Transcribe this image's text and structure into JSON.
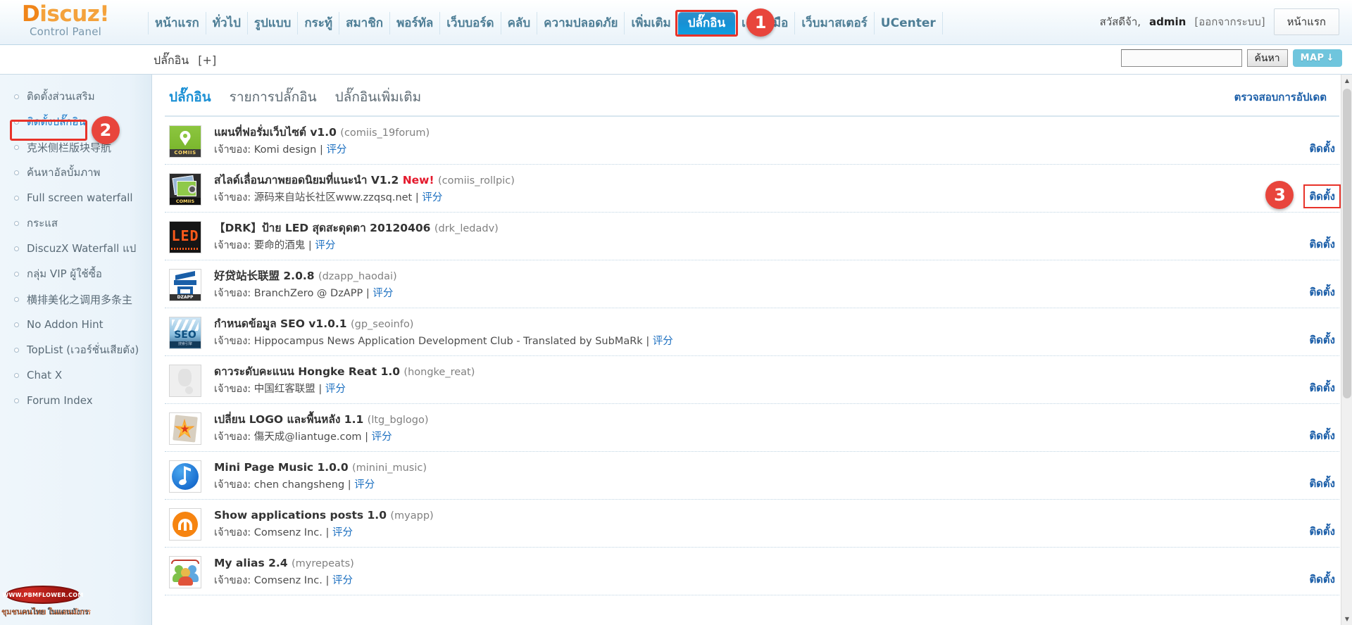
{
  "brand": {
    "name_d": "D",
    "name_rest": "iscuz!",
    "subtitle": "Control Panel"
  },
  "topnav": {
    "items": [
      {
        "label": "หน้าแรก",
        "active": false
      },
      {
        "label": "ทั่วไป",
        "active": false
      },
      {
        "label": "รูปแบบ",
        "active": false
      },
      {
        "label": "กระทู้",
        "active": false
      },
      {
        "label": "สมาชิก",
        "active": false
      },
      {
        "label": "พอร์ทัล",
        "active": false
      },
      {
        "label": "เว็บบอร์ด",
        "active": false
      },
      {
        "label": "คลับ",
        "active": false
      },
      {
        "label": "ความปลอดภัย",
        "active": false
      },
      {
        "label": "เพิ่มเติม",
        "active": false
      },
      {
        "label": "ปลั๊กอิน",
        "active": true
      },
      {
        "label": "เครื่องมือ",
        "active": false
      },
      {
        "label": "เว็บมาสเตอร์",
        "active": false
      },
      {
        "label": "UCenter",
        "active": false
      }
    ]
  },
  "user": {
    "greeting": "สวัสดีจ้า,",
    "username": "admin",
    "logout": "[ออกจากระบบ]",
    "home_button": "หน้าแรก"
  },
  "subbar": {
    "breadcrumb": "ปลั๊กอิน",
    "expand": "[+]",
    "search_value": "",
    "search_placeholder": "",
    "search_button": "ค้นหา",
    "map_button": "MAP"
  },
  "sidebar": {
    "items": [
      {
        "label": "ติดตั้งส่วนเสริม",
        "selected": false
      },
      {
        "label": "ติดตั้งปลั๊กอิน",
        "selected": true
      },
      {
        "label": "克米侧栏版块导航",
        "selected": false
      },
      {
        "label": "ค้นหาอัลบั้มภาพ",
        "selected": false
      },
      {
        "label": "Full screen waterfall",
        "selected": false
      },
      {
        "label": "กระแส",
        "selected": false
      },
      {
        "label": "DiscuzX Waterfall แป",
        "selected": false
      },
      {
        "label": "กลุ่ม VIP ผู้ใช้ซื้อ",
        "selected": false
      },
      {
        "label": "横排美化之调用多条主",
        "selected": false
      },
      {
        "label": "No Addon Hint",
        "selected": false
      },
      {
        "label": "TopList (เวอร์ชั่นเสียตัง)",
        "selected": false
      },
      {
        "label": "Chat X",
        "selected": false
      },
      {
        "label": "Forum Index",
        "selected": false
      }
    ]
  },
  "content": {
    "tabs": [
      {
        "label": "ปลั๊กอิน",
        "active": true
      },
      {
        "label": "รายการปลั๊กอิน",
        "active": false
      },
      {
        "label": "ปลั๊กอินเพิ่มเติม",
        "active": false
      }
    ],
    "check_update": "ตรวจสอบการอัปเดต",
    "owner_prefix": "เจ้าของ:",
    "rate_label": "评分",
    "install_label": "ติดตั้ง",
    "plugins": [
      {
        "title": "แผนที่ฟอรั่มเว็บไซต์ v1.0",
        "id": "(comiis_19forum)",
        "is_new": false,
        "new_label": "",
        "author": "Komi design",
        "icon": "map-pin-icon",
        "icon_text": "COMIIS"
      },
      {
        "title": "สไลด์เลื่อนภาพยอดนิยมที่แนะนำ V1.2",
        "id": "(comiis_rollpic)",
        "is_new": true,
        "new_label": "New!",
        "author": "源码来自站长社区www.zzqsq.net",
        "icon": "photo-slider-icon",
        "icon_text": "COMIIS"
      },
      {
        "title": "【DRK】ป้าย LED สุดสะดุดตา 20120406",
        "id": "(drk_ledadv)",
        "is_new": false,
        "new_label": "",
        "author": "要命的酒鬼",
        "icon": "led-sign-icon",
        "icon_text": "LED"
      },
      {
        "title": "好贷站长联盟 2.0.8",
        "id": "(dzapp_haodai)",
        "is_new": false,
        "new_label": "",
        "author": "BranchZero @ DzAPP",
        "icon": "dzapp-icon",
        "icon_text": "DZAPP"
      },
      {
        "title": "กำหนดข้อมูล SEO v1.0.1",
        "id": "(gp_seoinfo)",
        "is_new": false,
        "new_label": "",
        "author": "Hippocampus News Application Development Club - Translated by SubMaRk",
        "icon": "seo-icon",
        "icon_text": "SEO"
      },
      {
        "title": "ดาวระดับคะแนน Hongke Reat 1.0",
        "id": "(hongke_reat)",
        "is_new": false,
        "new_label": "",
        "author": "中国红客联盟",
        "icon": "blank-icon",
        "icon_text": ""
      },
      {
        "title": "เปลี่ยน LOGO และพื้นหลัง 1.1",
        "id": "(ltg_bglogo)",
        "is_new": false,
        "new_label": "",
        "author": "傷天成@liantuge.com",
        "icon": "star-burst-icon",
        "icon_text": ""
      },
      {
        "title": "Mini Page Music 1.0.0",
        "id": "(minini_music)",
        "is_new": false,
        "new_label": "",
        "author": "chen changsheng",
        "icon": "music-note-icon",
        "icon_text": ""
      },
      {
        "title": "Show applications posts 1.0",
        "id": "(myapp)",
        "is_new": false,
        "new_label": "",
        "author": "Comsenz Inc.",
        "icon": "comsenz-m-icon",
        "icon_text": ""
      },
      {
        "title": "My alias 2.4",
        "id": "(myrepeats)",
        "is_new": false,
        "new_label": "",
        "author": "Comsenz Inc.",
        "icon": "users-group-icon",
        "icon_text": ""
      }
    ]
  },
  "markers": [
    {
      "number": "1"
    },
    {
      "number": "2"
    },
    {
      "number": "3"
    }
  ],
  "watermark": {
    "oval_text": "WWW.PBMFLOWER.COM",
    "line_thai": "ชุมชนคนไทย ในแดนมังกร",
    "line_sub": ""
  },
  "colors": {
    "accent_blue": "#1a8fd4",
    "brand_orange": "#f08519",
    "marker_red": "#e8453c",
    "link_blue": "#1b5ea8"
  }
}
